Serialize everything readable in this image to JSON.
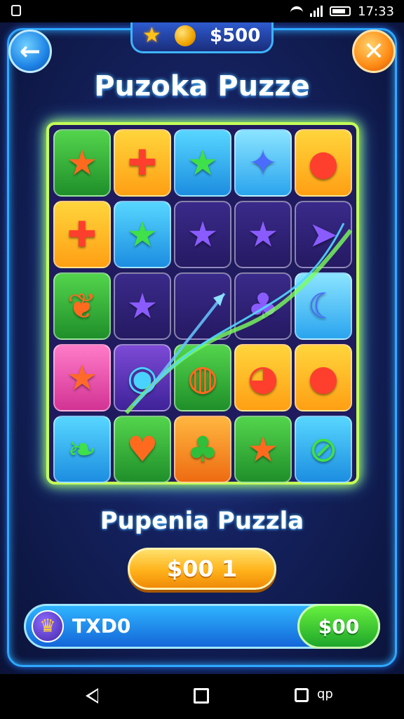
{
  "status_bar": {
    "time": "17:33"
  },
  "header": {
    "coins": "500",
    "back_icon": "←",
    "close_icon": "✕",
    "title": "Puzoka Puzze"
  },
  "board": {
    "tiles": [
      {
        "color": "green",
        "icon": "★",
        "icon_name": "star-icon"
      },
      {
        "color": "yellow",
        "icon": "✚",
        "icon_name": "cross-icon"
      },
      {
        "color": "blue",
        "icon": "★",
        "icon_name": "star-icon"
      },
      {
        "color": "lightblue",
        "icon": "✦",
        "icon_name": "star-icon"
      },
      {
        "color": "yellow",
        "icon": "●",
        "icon_name": "orb-icon"
      },
      {
        "color": "yellow",
        "icon": "✚",
        "icon_name": "cross-icon"
      },
      {
        "color": "blue",
        "icon": "★",
        "icon_name": "star-icon"
      },
      {
        "color": "dark",
        "icon": "★",
        "icon_name": "star-icon"
      },
      {
        "color": "dark",
        "icon": "★",
        "icon_name": "star-icon"
      },
      {
        "color": "dark",
        "icon": "➤",
        "icon_name": "rocket-icon"
      },
      {
        "color": "green",
        "icon": "❦",
        "icon_name": "pinecone-icon"
      },
      {
        "color": "dark",
        "icon": "★",
        "icon_name": "star-icon"
      },
      {
        "color": "dark",
        "icon": "",
        "icon_name": "empty"
      },
      {
        "color": "dark",
        "icon": "♣",
        "icon_name": "palm-tree-icon"
      },
      {
        "color": "lightblue",
        "icon": "☾",
        "icon_name": "moon-icon"
      },
      {
        "color": "pink",
        "icon": "★",
        "icon_name": "star-icon"
      },
      {
        "color": "purple",
        "icon": "◉",
        "icon_name": "eye-icon"
      },
      {
        "color": "green",
        "icon": "◍",
        "icon_name": "blob-icon"
      },
      {
        "color": "yellow",
        "icon": "◕",
        "icon_name": "creature-icon"
      },
      {
        "color": "yellow",
        "icon": "●",
        "icon_name": "orb-icon"
      },
      {
        "color": "blue",
        "icon": "❧",
        "icon_name": "leaf-icon"
      },
      {
        "color": "green",
        "icon": "♥",
        "icon_name": "shield-icon"
      },
      {
        "color": "orange",
        "icon": "♣",
        "icon_name": "palm-tree-icon"
      },
      {
        "color": "green",
        "icon": "★",
        "icon_name": "star-icon"
      },
      {
        "color": "blue",
        "icon": "⊘",
        "icon_name": "racket-icon"
      }
    ]
  },
  "colors": {
    "green": "c-green",
    "yellow": "c-yellow",
    "blue": "c-blue",
    "lightblue": "c-lightblue",
    "purple": "c-purple",
    "pink": "c-pink",
    "orange": "c-orange",
    "dark": "c-dark",
    "icon_tint": {
      "green": "#ff6a1f",
      "yellow": "#ff3f2d",
      "blue": "#3fe04a",
      "lightblue": "#4a6cff",
      "purple": "#4ad2ff",
      "pink": "#ff6a2a",
      "orange": "#2fbf3a",
      "dark": "#8a5cff"
    }
  },
  "footer": {
    "subtitle": "Pupenia Puzzla",
    "play_label": "$00 1",
    "bar_label": "TXD0",
    "bar_value": "$00"
  },
  "nav": {
    "extra_text": "qp"
  }
}
